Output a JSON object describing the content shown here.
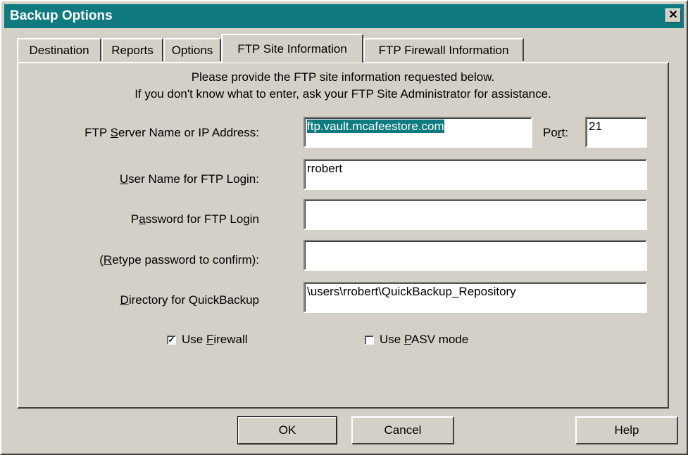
{
  "window": {
    "title": "Backup Options",
    "close_glyph": "✕"
  },
  "tabs": [
    {
      "label": "Destination",
      "active": false
    },
    {
      "label": "Reports",
      "active": false
    },
    {
      "label": "Options",
      "active": false
    },
    {
      "label": "FTP Site Information",
      "active": true
    },
    {
      "label": "FTP Firewall Information",
      "active": false
    }
  ],
  "instructions": {
    "line1": "Please provide the FTP site information requested below.",
    "line2": "If you don't know what to enter, ask your FTP Site Administrator for assistance."
  },
  "fields": {
    "server": {
      "label_pre": "FTP ",
      "label_key": "S",
      "label_post": "erver Name or IP Address:",
      "value": "ftp.vault.mcafeestore.com"
    },
    "port": {
      "label_pre": "Po",
      "label_key": "r",
      "label_post": "t:",
      "value": "21"
    },
    "username": {
      "label_pre": "",
      "label_key": "U",
      "label_post": "ser Name for FTP Login:",
      "value": "rrobert"
    },
    "password": {
      "label_pre": "P",
      "label_key": "a",
      "label_post": "ssword for FTP Login",
      "value": ""
    },
    "retype": {
      "label_pre": "(",
      "label_key": "R",
      "label_post": "etype password to confirm):",
      "value": ""
    },
    "directory": {
      "label_pre": "",
      "label_key": "D",
      "label_post": "irectory for QuickBackup",
      "value": "\\users\\rrobert\\QuickBackup_Repository"
    }
  },
  "checkboxes": {
    "firewall": {
      "label_pre": "Use ",
      "label_key": "F",
      "label_post": "irewall",
      "checked": true,
      "mark": "✓"
    },
    "pasv": {
      "label_pre": "Use ",
      "label_key": "P",
      "label_post": "ASV mode",
      "checked": false,
      "mark": ""
    }
  },
  "buttons": {
    "ok": "OK",
    "cancel": "Cancel",
    "help": "Help"
  },
  "colors": {
    "face": "#d4d0c8",
    "titlebar": "#0f7b80",
    "selection": "#0f7b80"
  }
}
